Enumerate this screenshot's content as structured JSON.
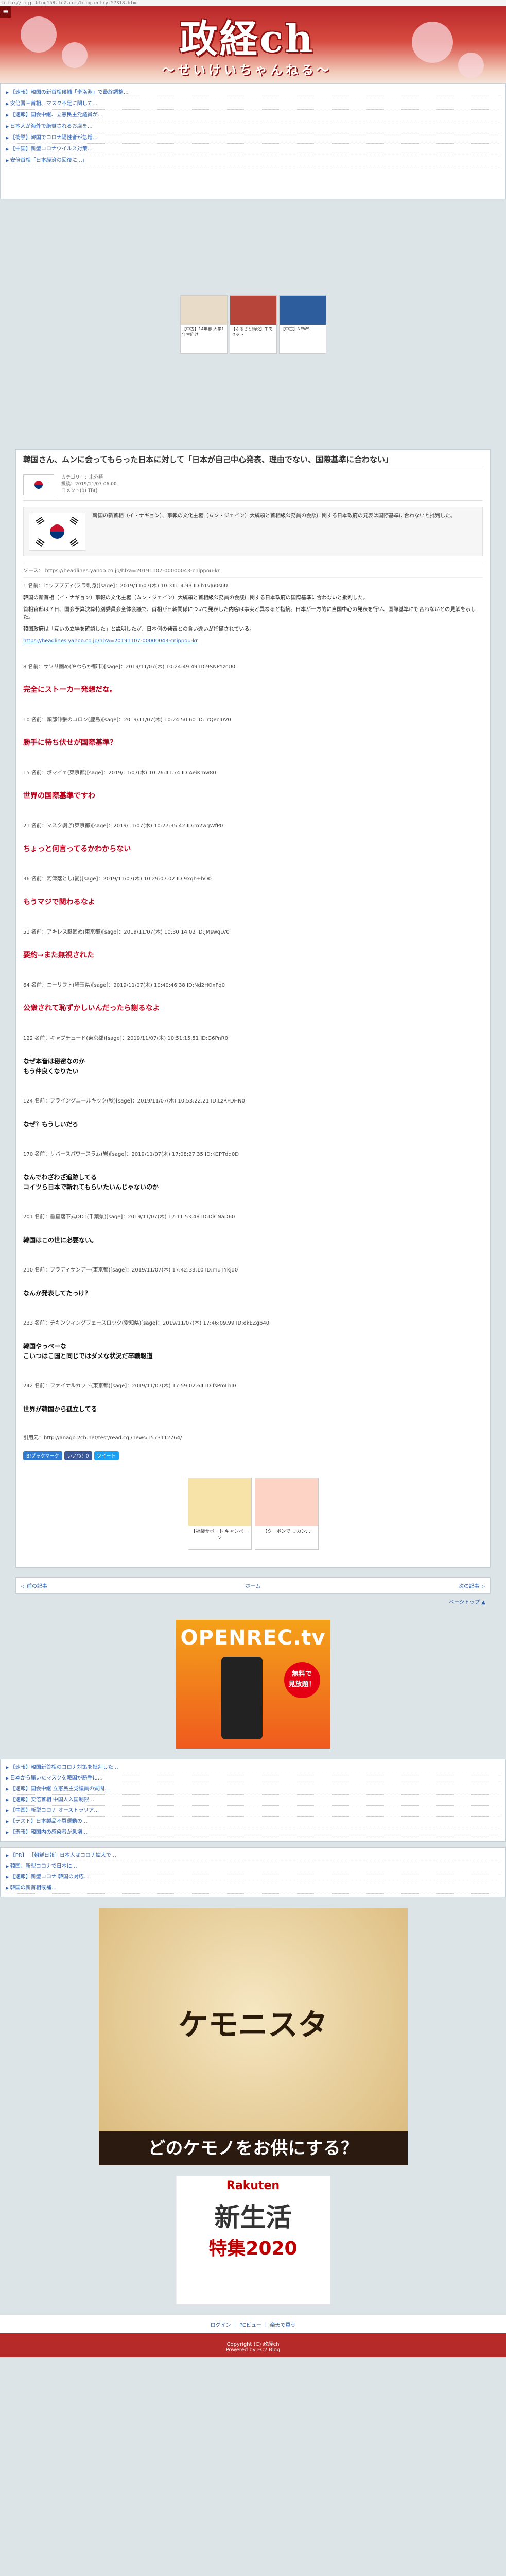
{
  "url": "http://fcjp.blog158.fc2.com/blog-entry-57318.html",
  "logo": {
    "title": "政経ch",
    "subtitle": "～せいけいちゃんねる～"
  },
  "top_news": [
    "【速報】韓国の新首相候補「李洛淵」で最終調整…",
    "安倍晋三首相、マスク不足に関して…",
    "【速報】国会中継、立憲民主党議員が…",
    "日本人が海外で絶賛されるお店を…",
    "【衝撃】韓国でコロナ陽性者が急増…",
    "【中国】新型コロナウイルス対策…",
    "安倍首相「日本経済の回復に…」"
  ],
  "ad_cards": [
    {
      "label": "【中古】14年春 大学1年生向け"
    },
    {
      "label": "【ふるさと納税】牛肉セット"
    },
    {
      "label": "【中古】NEWS"
    }
  ],
  "article": {
    "title": "韓国さん、ムンに会ってもらった日本に対して「日本が自己中心発表、理由でない、国際基準に合わない」",
    "meta_category": "カテゴリー：未分類",
    "meta_date": "投稿：2019/11/07 06:00",
    "meta_comments": "コメント(0)  TB()",
    "quote_text": "韓国の新首相（イ・ナギョン）、事報の文化主権（ムン・ジェイン）大統領と首相級公務員の会談に関する日本政府の発表は国際基準に合わないと批判した。",
    "source": "ソース： https://headlines.yahoo.co.jp/hl?a=20191107-00000043-cnippou-kr",
    "r1_head": "1 名前：ヒッププディ(プラ刺身)[sage]：2019/11/07(木) 10:31:14.93 ID:h1vJu0sIjU",
    "body_p1": "韓国の新首相（イ・ナギョン）事報の文化主権（ムン・ジェイン）大統領と首相級公務員の会談に関する日本政府の国際基準に合わないと批判した。",
    "body_p2": "首相官邸は７日、国会予算決算特別委員会全体会議で、首相が日韓関係について発表した内容は事実と異なると指摘。日本が一方的に自国中心の発表を行い、国際基準にも合わないとの見解を示した。",
    "body_p3": "韓国政府は「互いの立場を確認した」と説明したが、日本側の発表との食い違いが指摘されている。",
    "body_link": "https://headlines.yahoo.co.jp/hl?a=20191107-00000043-cnippou-kr"
  },
  "responses": [
    {
      "head": "8 名前：サソリ固め(やわらか都市)[sage]：2019/11/07(木) 10:24:49.49 ID:9SNPYzcU0",
      "body": "完全にストーカー発想だな。",
      "style": "red"
    },
    {
      "head": "10 名前：頭部伸張のコロン(鹿島)[sage]：2019/11/07(木) 10:24:50.60 ID:LrQecJ0V0",
      "body": "勝手に待ち伏せが国際基準？",
      "style": "red"
    },
    {
      "head": "15 名前：ボマイェ(東京都)[sage]：2019/11/07(木) 10:26:41.74 ID:AeiKmw80",
      "body": "世界の国際基準ですわ",
      "style": "red"
    },
    {
      "head": "21 名前：マスク剥ぎ(東京都)[sage]：2019/11/07(木) 10:27:35.42 ID:m2wgWfP0",
      "body": "ちょっと何言ってるかわからない",
      "style": "red"
    },
    {
      "head": "36 名前：河津落とし(愛)[sage]：2019/11/07(木) 10:29:07.02 ID:9xqh+bO0",
      "body": "もうマジで関わるなよ",
      "style": "red"
    },
    {
      "head": "51 名前：アキレス腱固め(東京都)[sage]：2019/11/07(木) 10:30:14.02 ID:jMswqLV0",
      "body": "要約→また無視された",
      "style": "red"
    },
    {
      "head": "64 名前：ニーリフト(埼玉県)[sage]：2019/11/07(木) 10:40:46.38 ID:Nd2HOxFq0",
      "body": "公衆されて恥ずかしいんだったら謝るなよ",
      "style": "red"
    },
    {
      "head": "122 名前：キャプチュード(東京都)[sage]：2019/11/07(木) 10:51:15.51 ID:G6PnR0",
      "body": "なぜ本音は秘密なのか\nもう仲良くなりたい",
      "style": "blk"
    },
    {
      "head": "124 名前：フライングニールキック(秋)[sage]：2019/11/07(木) 10:53:22.21 ID:LzRFDHN0",
      "body": "なぜ？もうしいだろ",
      "style": "blk"
    },
    {
      "head": "170 名前：リバースパワースラム(岩)[sage]：2019/11/07(木) 17:08:27.35 ID:KCPTdd0D",
      "body": "なんでわざわざ追跡してる\nコイツら日本で斬れてもらいたいんじゃないのか",
      "style": "blk"
    },
    {
      "head": "201 名前：垂直落下式DDT(千葉県)[sage]：2019/11/07(木) 17:11:53.48 ID:DiCNaD60",
      "body": "韓国はこの世に必要ない。",
      "style": "blk"
    },
    {
      "head": "210 名前：ブラディサンデー(東京都)[sage]：2019/11/07(木) 17:42:33.10 ID:muTYkjd0",
      "body": "なんか発表してたっけ？",
      "style": "blk"
    },
    {
      "head": "233 名前：チキンウィングフェースロック(愛知県)[sage]：2019/11/07(木) 17:46:09.99 ID:ekEZgb40",
      "body": "韓国やっぺーな\nこいつはこ国と同じではダメな状況だ卒職報道",
      "style": "blk"
    },
    {
      "head": "242 名前：ファイナルカット(東京都)[sage]：2019/11/07(木) 17:59:02.64 ID:fsPmLhI0",
      "body": "世界が韓国から孤立してる",
      "style": "blk"
    }
  ],
  "source_footer": "引用元：http://anago.2ch.net/test/read.cgi/news/1573112764/",
  "share": [
    "B!ブックマーク",
    "いいね！0",
    "ツイート"
  ],
  "ads2": [
    {
      "label": "【福袋サポート キャンペーン"
    },
    {
      "label": "【クーポンで リカン..."
    }
  ],
  "nav": {
    "prev": "◁ 前の記事",
    "home": "ホーム",
    "next": "次の記事 ▷"
  },
  "pagetop": "ページトップ ▲",
  "openrec": {
    "logo": "OPENREC.tv",
    "badge": "無料で\n見放題！"
  },
  "side_news_1": [
    "【速報】韓国新首相のコロナ対策を批判した…",
    "日本から届いたマスクを韓国が勝手に…",
    "【速報】国会中継 立憲民主党議員の質問…",
    "【速報】安倍首相 中国人入国制限…",
    "【中国】新型コロナ オーストラリア…",
    "【テスト】日本製品不買運動の…",
    "【悲報】韓国内の感染者が急増…"
  ],
  "side_news_2": [
    "【PR】 ［朝鮮日報］日本人はコロナ拡大で…",
    "韓国、新型コロナで日本に…",
    "【速報】新型コロナ 韓国の対応…",
    "韓国の新首相候補…"
  ],
  "kemo": {
    "title": "ケモニスタ",
    "tagline": "どのケモノをお供にする？"
  },
  "rakuten": {
    "brand": "Rakuten",
    "line1": "新生活",
    "line2": "特集2020"
  },
  "footer_links": "ログイン ｜ PCビュー ｜ 楽天で買う",
  "copyright": "Copyright (C) 政経ch",
  "powered": "Powered by FC2 Blog"
}
